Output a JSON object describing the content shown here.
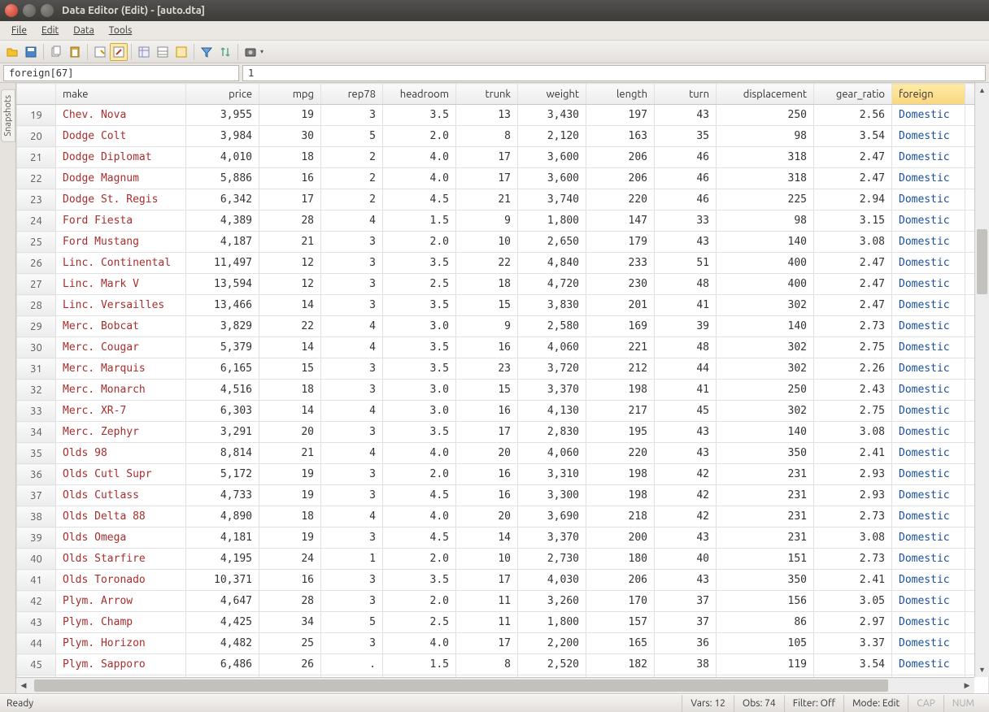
{
  "window": {
    "title": "Data Editor (Edit) - [auto.dta]"
  },
  "menu": [
    "File",
    "Edit",
    "Data",
    "Tools"
  ],
  "formula": {
    "ref": "foreign[67]",
    "value": "1"
  },
  "sidebar": {
    "tab": "Snapshots"
  },
  "columns": [
    "make",
    "price",
    "mpg",
    "rep78",
    "headroom",
    "trunk",
    "weight",
    "length",
    "turn",
    "displacement",
    "gear_ratio",
    "foreign"
  ],
  "selected_column": "foreign",
  "rows": [
    {
      "n": 19,
      "make": "Chev. Nova",
      "price": "3,955",
      "mpg": "19",
      "rep78": "3",
      "headroom": "3.5",
      "trunk": "13",
      "weight": "3,430",
      "length": "197",
      "turn": "43",
      "displacement": "250",
      "gear_ratio": "2.56",
      "foreign": "Domestic"
    },
    {
      "n": 20,
      "make": "Dodge Colt",
      "price": "3,984",
      "mpg": "30",
      "rep78": "5",
      "headroom": "2.0",
      "trunk": "8",
      "weight": "2,120",
      "length": "163",
      "turn": "35",
      "displacement": "98",
      "gear_ratio": "3.54",
      "foreign": "Domestic"
    },
    {
      "n": 21,
      "make": "Dodge Diplomat",
      "price": "4,010",
      "mpg": "18",
      "rep78": "2",
      "headroom": "4.0",
      "trunk": "17",
      "weight": "3,600",
      "length": "206",
      "turn": "46",
      "displacement": "318",
      "gear_ratio": "2.47",
      "foreign": "Domestic"
    },
    {
      "n": 22,
      "make": "Dodge Magnum",
      "price": "5,886",
      "mpg": "16",
      "rep78": "2",
      "headroom": "4.0",
      "trunk": "17",
      "weight": "3,600",
      "length": "206",
      "turn": "46",
      "displacement": "318",
      "gear_ratio": "2.47",
      "foreign": "Domestic"
    },
    {
      "n": 23,
      "make": "Dodge St. Regis",
      "price": "6,342",
      "mpg": "17",
      "rep78": "2",
      "headroom": "4.5",
      "trunk": "21",
      "weight": "3,740",
      "length": "220",
      "turn": "46",
      "displacement": "225",
      "gear_ratio": "2.94",
      "foreign": "Domestic"
    },
    {
      "n": 24,
      "make": "Ford Fiesta",
      "price": "4,389",
      "mpg": "28",
      "rep78": "4",
      "headroom": "1.5",
      "trunk": "9",
      "weight": "1,800",
      "length": "147",
      "turn": "33",
      "displacement": "98",
      "gear_ratio": "3.15",
      "foreign": "Domestic"
    },
    {
      "n": 25,
      "make": "Ford Mustang",
      "price": "4,187",
      "mpg": "21",
      "rep78": "3",
      "headroom": "2.0",
      "trunk": "10",
      "weight": "2,650",
      "length": "179",
      "turn": "43",
      "displacement": "140",
      "gear_ratio": "3.08",
      "foreign": "Domestic"
    },
    {
      "n": 26,
      "make": "Linc. Continental",
      "price": "11,497",
      "mpg": "12",
      "rep78": "3",
      "headroom": "3.5",
      "trunk": "22",
      "weight": "4,840",
      "length": "233",
      "turn": "51",
      "displacement": "400",
      "gear_ratio": "2.47",
      "foreign": "Domestic"
    },
    {
      "n": 27,
      "make": "Linc. Mark V",
      "price": "13,594",
      "mpg": "12",
      "rep78": "3",
      "headroom": "2.5",
      "trunk": "18",
      "weight": "4,720",
      "length": "230",
      "turn": "48",
      "displacement": "400",
      "gear_ratio": "2.47",
      "foreign": "Domestic"
    },
    {
      "n": 28,
      "make": "Linc. Versailles",
      "price": "13,466",
      "mpg": "14",
      "rep78": "3",
      "headroom": "3.5",
      "trunk": "15",
      "weight": "3,830",
      "length": "201",
      "turn": "41",
      "displacement": "302",
      "gear_ratio": "2.47",
      "foreign": "Domestic"
    },
    {
      "n": 29,
      "make": "Merc. Bobcat",
      "price": "3,829",
      "mpg": "22",
      "rep78": "4",
      "headroom": "3.0",
      "trunk": "9",
      "weight": "2,580",
      "length": "169",
      "turn": "39",
      "displacement": "140",
      "gear_ratio": "2.73",
      "foreign": "Domestic"
    },
    {
      "n": 30,
      "make": "Merc. Cougar",
      "price": "5,379",
      "mpg": "14",
      "rep78": "4",
      "headroom": "3.5",
      "trunk": "16",
      "weight": "4,060",
      "length": "221",
      "turn": "48",
      "displacement": "302",
      "gear_ratio": "2.75",
      "foreign": "Domestic"
    },
    {
      "n": 31,
      "make": "Merc. Marquis",
      "price": "6,165",
      "mpg": "15",
      "rep78": "3",
      "headroom": "3.5",
      "trunk": "23",
      "weight": "3,720",
      "length": "212",
      "turn": "44",
      "displacement": "302",
      "gear_ratio": "2.26",
      "foreign": "Domestic"
    },
    {
      "n": 32,
      "make": "Merc. Monarch",
      "price": "4,516",
      "mpg": "18",
      "rep78": "3",
      "headroom": "3.0",
      "trunk": "15",
      "weight": "3,370",
      "length": "198",
      "turn": "41",
      "displacement": "250",
      "gear_ratio": "2.43",
      "foreign": "Domestic"
    },
    {
      "n": 33,
      "make": "Merc. XR-7",
      "price": "6,303",
      "mpg": "14",
      "rep78": "4",
      "headroom": "3.0",
      "trunk": "16",
      "weight": "4,130",
      "length": "217",
      "turn": "45",
      "displacement": "302",
      "gear_ratio": "2.75",
      "foreign": "Domestic"
    },
    {
      "n": 34,
      "make": "Merc. Zephyr",
      "price": "3,291",
      "mpg": "20",
      "rep78": "3",
      "headroom": "3.5",
      "trunk": "17",
      "weight": "2,830",
      "length": "195",
      "turn": "43",
      "displacement": "140",
      "gear_ratio": "3.08",
      "foreign": "Domestic"
    },
    {
      "n": 35,
      "make": "Olds 98",
      "price": "8,814",
      "mpg": "21",
      "rep78": "4",
      "headroom": "4.0",
      "trunk": "20",
      "weight": "4,060",
      "length": "220",
      "turn": "43",
      "displacement": "350",
      "gear_ratio": "2.41",
      "foreign": "Domestic"
    },
    {
      "n": 36,
      "make": "Olds Cutl Supr",
      "price": "5,172",
      "mpg": "19",
      "rep78": "3",
      "headroom": "2.0",
      "trunk": "16",
      "weight": "3,310",
      "length": "198",
      "turn": "42",
      "displacement": "231",
      "gear_ratio": "2.93",
      "foreign": "Domestic"
    },
    {
      "n": 37,
      "make": "Olds Cutlass",
      "price": "4,733",
      "mpg": "19",
      "rep78": "3",
      "headroom": "4.5",
      "trunk": "16",
      "weight": "3,300",
      "length": "198",
      "turn": "42",
      "displacement": "231",
      "gear_ratio": "2.93",
      "foreign": "Domestic"
    },
    {
      "n": 38,
      "make": "Olds Delta 88",
      "price": "4,890",
      "mpg": "18",
      "rep78": "4",
      "headroom": "4.0",
      "trunk": "20",
      "weight": "3,690",
      "length": "218",
      "turn": "42",
      "displacement": "231",
      "gear_ratio": "2.73",
      "foreign": "Domestic"
    },
    {
      "n": 39,
      "make": "Olds Omega",
      "price": "4,181",
      "mpg": "19",
      "rep78": "3",
      "headroom": "4.5",
      "trunk": "14",
      "weight": "3,370",
      "length": "200",
      "turn": "43",
      "displacement": "231",
      "gear_ratio": "3.08",
      "foreign": "Domestic"
    },
    {
      "n": 40,
      "make": "Olds Starfire",
      "price": "4,195",
      "mpg": "24",
      "rep78": "1",
      "headroom": "2.0",
      "trunk": "10",
      "weight": "2,730",
      "length": "180",
      "turn": "40",
      "displacement": "151",
      "gear_ratio": "2.73",
      "foreign": "Domestic"
    },
    {
      "n": 41,
      "make": "Olds Toronado",
      "price": "10,371",
      "mpg": "16",
      "rep78": "3",
      "headroom": "3.5",
      "trunk": "17",
      "weight": "4,030",
      "length": "206",
      "turn": "43",
      "displacement": "350",
      "gear_ratio": "2.41",
      "foreign": "Domestic"
    },
    {
      "n": 42,
      "make": "Plym. Arrow",
      "price": "4,647",
      "mpg": "28",
      "rep78": "3",
      "headroom": "2.0",
      "trunk": "11",
      "weight": "3,260",
      "length": "170",
      "turn": "37",
      "displacement": "156",
      "gear_ratio": "3.05",
      "foreign": "Domestic"
    },
    {
      "n": 43,
      "make": "Plym. Champ",
      "price": "4,425",
      "mpg": "34",
      "rep78": "5",
      "headroom": "2.5",
      "trunk": "11",
      "weight": "1,800",
      "length": "157",
      "turn": "37",
      "displacement": "86",
      "gear_ratio": "2.97",
      "foreign": "Domestic"
    },
    {
      "n": 44,
      "make": "Plym. Horizon",
      "price": "4,482",
      "mpg": "25",
      "rep78": "3",
      "headroom": "4.0",
      "trunk": "17",
      "weight": "2,200",
      "length": "165",
      "turn": "36",
      "displacement": "105",
      "gear_ratio": "3.37",
      "foreign": "Domestic"
    },
    {
      "n": 45,
      "make": "Plym. Sapporo",
      "price": "6,486",
      "mpg": "26",
      "rep78": ".",
      "headroom": "1.5",
      "trunk": "8",
      "weight": "2,520",
      "length": "182",
      "turn": "38",
      "displacement": "119",
      "gear_ratio": "3.54",
      "foreign": "Domestic"
    }
  ],
  "status": {
    "ready": "Ready",
    "vars": "Vars: 12",
    "obs": "Obs: 74",
    "filter": "Filter: Off",
    "mode": "Mode: Edit",
    "cap": "CAP",
    "num": "NUM"
  }
}
